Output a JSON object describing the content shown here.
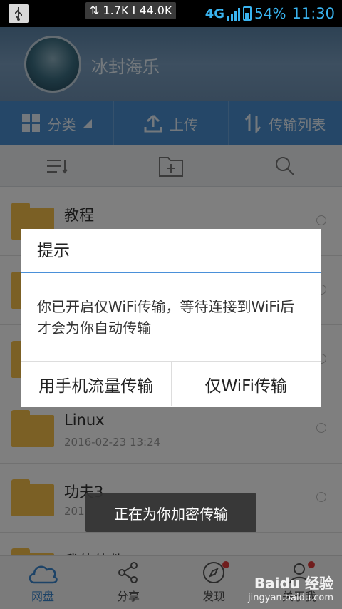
{
  "status_bar": {
    "speed": "⇅ 1.7K I 44.0K",
    "network": "4G",
    "battery": "54%",
    "time": "11:30"
  },
  "profile": {
    "username": "冰封海乐"
  },
  "tabs": [
    {
      "label": "分类"
    },
    {
      "label": "上传"
    },
    {
      "label": "传输列表"
    }
  ],
  "toolbar": {
    "icons": [
      "sort-icon",
      "new-folder-icon",
      "search-icon"
    ]
  },
  "files": [
    {
      "name": "教程",
      "date": ""
    },
    {
      "name": "",
      "date": ""
    },
    {
      "name": "",
      "date": ""
    },
    {
      "name": "Linux",
      "date": "2016-02-23  13:24"
    },
    {
      "name": "功夫3",
      "date": "201"
    },
    {
      "name": "我的软件",
      "date": ""
    }
  ],
  "dialog": {
    "title": "提示",
    "message": "你已开启仅WiFi传输，等待连接到WiFi后才会为你自动传输",
    "mobile_button": "用手机流量传输",
    "wifi_button": "仅WiFi传输"
  },
  "toast": {
    "text": "正在为你加密传输"
  },
  "bottom_nav": [
    {
      "label": "网盘"
    },
    {
      "label": "分享"
    },
    {
      "label": "发现"
    },
    {
      "label": "关于我"
    }
  ],
  "watermark": {
    "brand": "Baidu 经验",
    "url": "jingyan.baidu.com"
  },
  "colors": {
    "accent": "#4a8fd0",
    "folder": "#f6c04a",
    "badge": "#e03a3a"
  }
}
